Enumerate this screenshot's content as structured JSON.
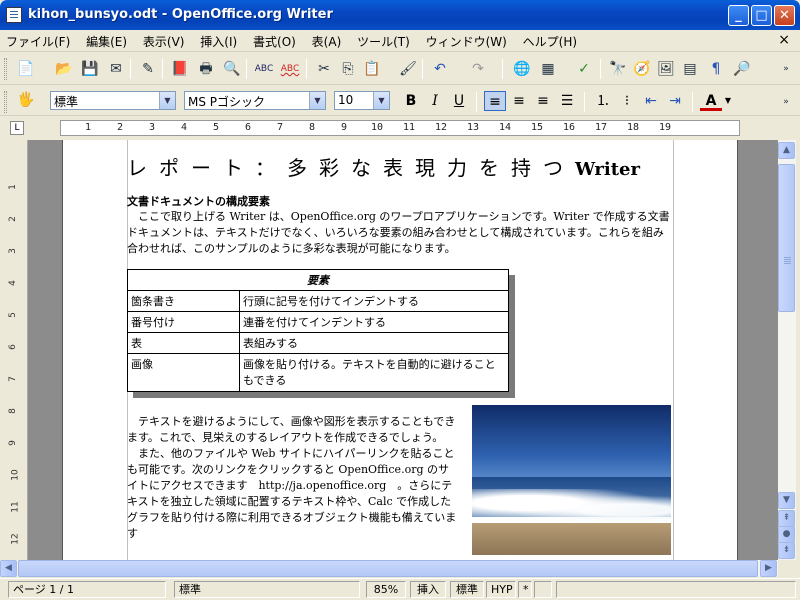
{
  "window": {
    "title": "kihon_bunsyo.odt - OpenOffice.org Writer"
  },
  "menu": {
    "items": [
      "ファイル(F)",
      "編集(E)",
      "表示(V)",
      "挿入(I)",
      "書式(O)",
      "表(A)",
      "ツール(T)",
      "ウィンドウ(W)",
      "ヘルプ(H)"
    ],
    "doc_close": "×"
  },
  "toolbar1": {
    "icons": [
      "new-document-icon",
      "open-icon",
      "save-icon",
      "email-icon",
      "edit-mode-icon",
      "export-pdf-icon",
      "print-icon",
      "page-preview-icon",
      "spellcheck-icon",
      "autospellcheck-icon",
      "cut-icon",
      "copy-icon",
      "paste-icon",
      "format-paintbrush-icon",
      "undo-icon",
      "redo-icon",
      "hyperlink-icon",
      "table-icon",
      "show-draw-functions-icon",
      "find-replace-icon",
      "navigator-icon",
      "gallery-icon",
      "data-sources-icon",
      "formatting-marks-icon",
      "zoom-icon"
    ]
  },
  "toolbar2": {
    "style_value": "標準",
    "font_value": "MS Pゴシック",
    "size_value": "10",
    "bold": "B",
    "italic": "I",
    "underline": "U",
    "font_color_label": "A"
  },
  "ruler": {
    "marks": [
      "1",
      "2",
      "3",
      "4",
      "5",
      "6",
      "7",
      "8",
      "9",
      "10",
      "11",
      "12",
      "13",
      "14",
      "15",
      "16",
      "17",
      "18",
      "19"
    ],
    "vmarks": [
      "1",
      "2",
      "3",
      "4",
      "5",
      "6",
      "7",
      "8",
      "9",
      "10",
      "11",
      "12"
    ]
  },
  "document": {
    "title": "レポート：多彩な表現力を持つ",
    "title_latin": "Writer",
    "section_heading": "文書ドキュメントの構成要素",
    "intro_paragraph": "　ここで取り上げる Writer は、OpenOffice.org のワープロアプリケーションです。Writer で作成する文書ドキュメントは、テキストだけでなく、いろいろな要素の組み合わせとして構成されています。これらを組み合わせれば、このサンプルのように多彩な表現が可能になります。",
    "table": {
      "header": "要素",
      "rows": [
        {
          "name": "箇条書き",
          "desc": "行頭に記号を付けてインデントする"
        },
        {
          "name": "番号付け",
          "desc": "連番を付けてインデントする"
        },
        {
          "name": "表",
          "desc": "表組みする"
        },
        {
          "name": "画像",
          "desc": "画像を貼り付ける。テキストを自動的に避けることもできる"
        }
      ]
    },
    "wrap_paragraph_1": "　テキストを避けるようにして、画像や図形を表示することもできます。これで、見栄えのするレイアウトを作成できるでしょう。",
    "wrap_paragraph_2": "　また、他のファイルや Web サイトにハイパーリンクを貼ることも可能です。次のリンクをクリックすると OpenOffice.org のサイトにアクセスできます　http://ja.openoffice.org　。さらにテキストを独立した領域に配置するテキスト枠や、Calc で作成したグラフを貼り付ける際に利用できるオブジェクト機能も備えています"
  },
  "statusbar": {
    "page": "ページ 1 / 1",
    "style": "標準",
    "zoom": "85%",
    "insert_mode": "挿入",
    "selection_mode": "標準",
    "hyperlink_mode": "HYP",
    "modified": "*"
  }
}
